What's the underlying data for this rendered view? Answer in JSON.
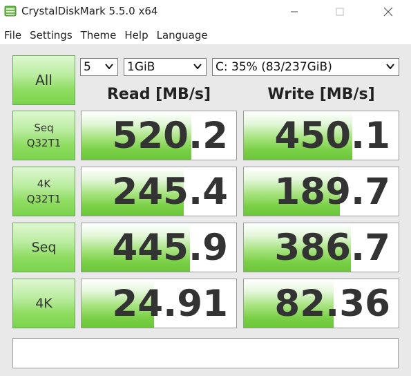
{
  "window": {
    "title": "CrystalDiskMark 5.5.0 x64"
  },
  "menu": [
    "File",
    "Settings",
    "Theme",
    "Help",
    "Language"
  ],
  "controls": {
    "all_label": "All",
    "count": "5",
    "size": "1GiB",
    "drive": "C: 35% (83/237GiB)"
  },
  "headers": {
    "read": "Read [MB/s]",
    "write": "Write [MB/s]"
  },
  "tests": [
    {
      "line1": "Seq",
      "line2": "Q32T1",
      "read": "520.2",
      "write": "450.1",
      "read_fill": 0.71,
      "write_fill": 0.7
    },
    {
      "line1": "4K",
      "line2": "Q32T1",
      "read": "245.4",
      "write": "189.7",
      "read_fill": 0.66,
      "write_fill": 0.62
    },
    {
      "line1": "Seq",
      "line2": "",
      "read": "445.9",
      "write": "386.7",
      "read_fill": 0.7,
      "write_fill": 0.69
    },
    {
      "line1": "4K",
      "line2": "",
      "read": "24.91",
      "write": "82.36",
      "read_fill": 0.47,
      "write_fill": 0.58
    }
  ],
  "comment": ""
}
